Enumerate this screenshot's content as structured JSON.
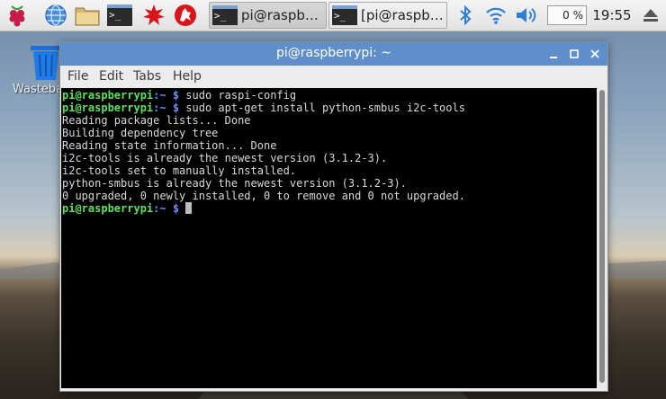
{
  "taskbar": {
    "tasks": [
      {
        "label": "pi@raspberry…",
        "icon": "terminal-icon",
        "active": true
      },
      {
        "label": "[pi@raspberr…",
        "icon": "terminal-icon",
        "active": false
      }
    ],
    "cpu_usage": "0 %",
    "clock": "19:55"
  },
  "desktop": {
    "trash_label": "Wastebasket"
  },
  "window": {
    "title": "pi@raspberrypi: ~",
    "menu": [
      "File",
      "Edit",
      "Tabs",
      "Help"
    ]
  },
  "terminal": {
    "lines": [
      {
        "user": "pi@raspberrypi",
        "path": ":~ $",
        "cmd": " sudo raspi-config"
      },
      {
        "user": "pi@raspberrypi",
        "path": ":~ $",
        "cmd": " sudo apt-get install python-smbus i2c-tools"
      },
      {
        "text": "Reading package lists... Done"
      },
      {
        "text": "Building dependency tree"
      },
      {
        "text": "Reading state information... Done"
      },
      {
        "text": "i2c-tools is already the newest version (3.1.2-3)."
      },
      {
        "text": "i2c-tools set to manually installed."
      },
      {
        "text": "python-smbus is already the newest version (3.1.2-3)."
      },
      {
        "text": "0 upgraded, 0 newly installed, 0 to remove and 0 not upgraded."
      },
      {
        "user": "pi@raspberrypi",
        "path": ":~ $",
        "cmd": " ",
        "cursor": true
      }
    ]
  }
}
